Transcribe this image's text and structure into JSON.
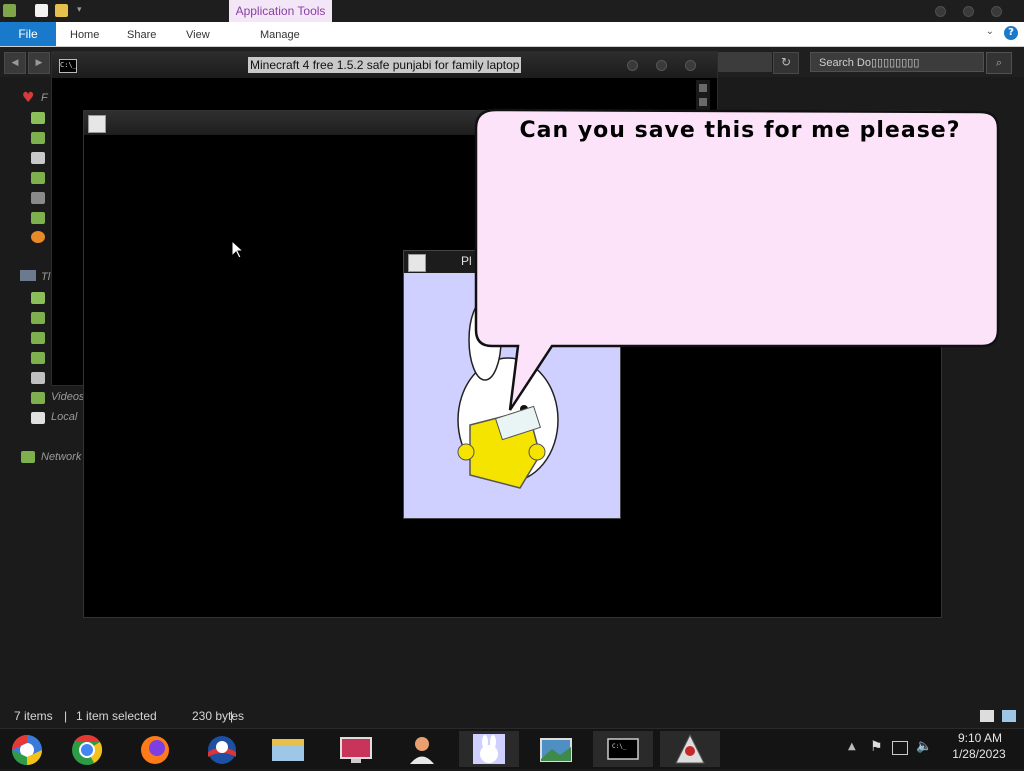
{
  "explorer": {
    "contextual_tab": "Application Tools",
    "tabs": {
      "file": "File",
      "home": "Home",
      "share": "Share",
      "view": "View",
      "manage": "Manage"
    },
    "search_placeholder": "Search Do\u0000\u0000\u0000\u0000\u0000\u0000",
    "status": {
      "items": "7 items",
      "selected": "1 item selected",
      "size": "230 bytes"
    },
    "nav": {
      "favorites_label": "F",
      "thispc_label": "Tl",
      "videos_label": "Videos",
      "local_label": "Local",
      "network_label": "Network"
    }
  },
  "console_window": {
    "title": "Minecraft 4 free 1.5.2 safe punjabi for family laptop",
    "icon_text": "C:\\_"
  },
  "pl_window": {
    "title_fragment": "Pl"
  },
  "speech_bubble": {
    "text": "Can you save this for me please?"
  },
  "taskbar": {
    "items": [
      "chrome-os-icon",
      "chrome-icon",
      "firefox-icon",
      "obama-logo-icon",
      "file-explorer-icon",
      "monitor-icon",
      "person-icon",
      "bunny-icon",
      "photo-viewer-icon",
      "console-icon",
      "java-icon"
    ],
    "clock_time": "9:10 AM",
    "clock_date": "1/28/2023"
  },
  "colors": {
    "accent": "#1979ca",
    "contextual_tab": "#f3e6f7",
    "bubble_fill": "#fde3fa",
    "pl_background": "#cfd0ff"
  }
}
